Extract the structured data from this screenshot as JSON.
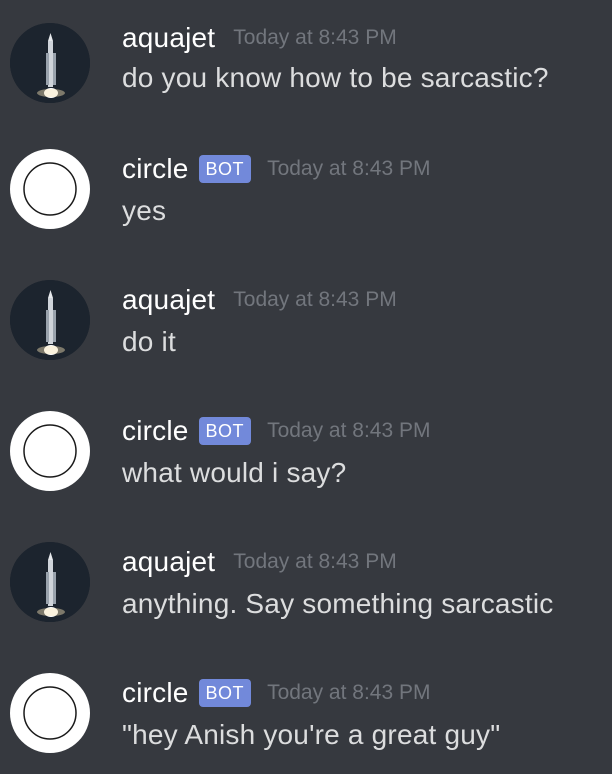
{
  "messages": [
    {
      "author": "aquajet",
      "bot_badge": "",
      "timestamp": "Today at 8:43 PM",
      "text": "do you know how to be sarcastic?",
      "avatar_icon": "rocket-launch-avatar"
    },
    {
      "author": "circle",
      "bot_badge": "BOT",
      "timestamp": "Today at 8:43 PM",
      "text": "yes",
      "avatar_icon": "circle-avatar"
    },
    {
      "author": "aquajet",
      "bot_badge": "",
      "timestamp": "Today at 8:43 PM",
      "text": "do it",
      "avatar_icon": "rocket-launch-avatar"
    },
    {
      "author": "circle",
      "bot_badge": "BOT",
      "timestamp": "Today at 8:43 PM",
      "text": "what would i say?",
      "avatar_icon": "circle-avatar"
    },
    {
      "author": "aquajet",
      "bot_badge": "",
      "timestamp": "Today at 8:43 PM",
      "text": "anything. Say something sarcastic",
      "avatar_icon": "rocket-launch-avatar"
    },
    {
      "author": "circle",
      "bot_badge": "BOT",
      "timestamp": "Today at 8:43 PM",
      "text": "\"hey Anish you're a great guy\"",
      "avatar_icon": "circle-avatar"
    }
  ],
  "colors": {
    "background": "#36393f",
    "username": "#ffffff",
    "message_text": "#dcddde",
    "timestamp": "#72767d",
    "bot_badge": "#7289da"
  }
}
